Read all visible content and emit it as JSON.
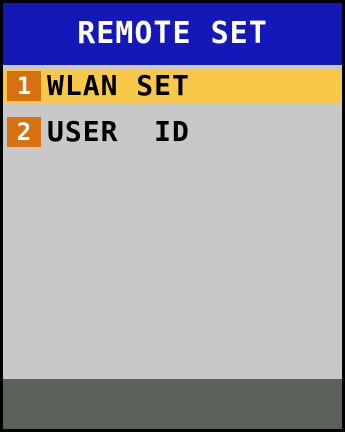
{
  "screen": {
    "title": "REMOTE SET"
  },
  "menu": {
    "items": [
      {
        "number": "1",
        "label": "WLAN SET",
        "selected": true
      },
      {
        "number": "2",
        "label": "USER  ID",
        "selected": false
      }
    ]
  },
  "colors": {
    "title_bg": "#1418b8",
    "title_text": "#ffffff",
    "body_bg": "#c8c8c8",
    "selected_bg": "#f8c848",
    "badge_bg": "#d87010",
    "footer_bg": "#5a605a",
    "border": "#000000"
  }
}
